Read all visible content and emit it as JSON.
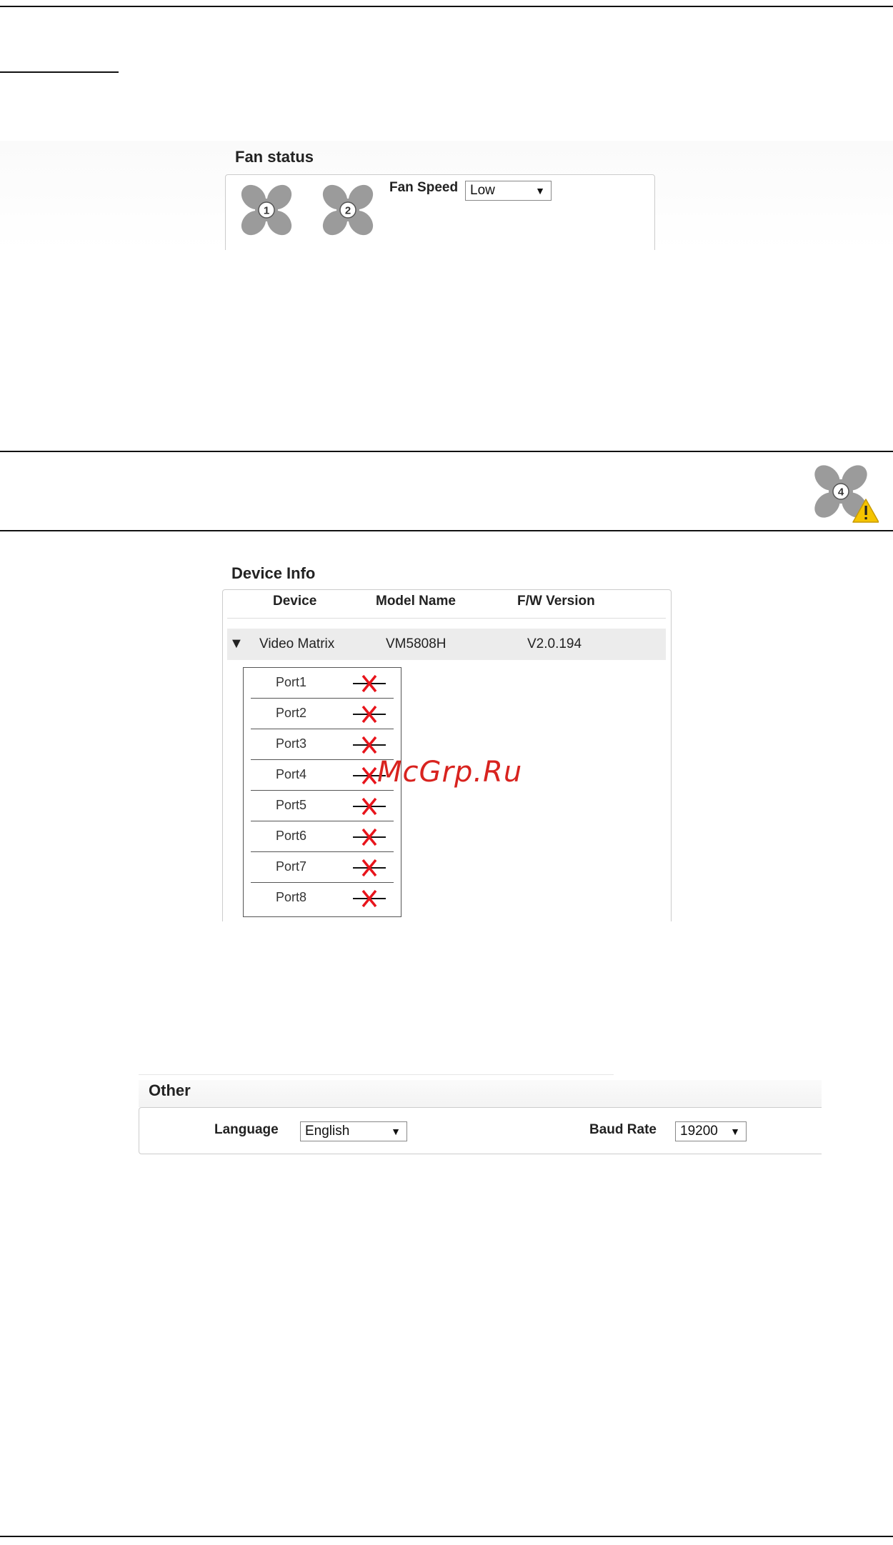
{
  "fan_status": {
    "title": "Fan status",
    "fans": [
      {
        "number": "1",
        "icon": "fan-icon"
      },
      {
        "number": "2",
        "icon": "fan-icon"
      }
    ],
    "speed_label": "Fan Speed",
    "speed_value": "Low"
  },
  "fan_warning": {
    "number": "4",
    "icon": "fan-warning-icon"
  },
  "device_info": {
    "title": "Device Info",
    "headers": [
      "Device",
      "Model Name",
      "F/W Version"
    ],
    "device": {
      "name": "Video Matrix",
      "model": "VM5808H",
      "firmware": "V2.0.194",
      "expand_icon": "triangle-down-icon"
    },
    "ports": [
      {
        "label": "Port1",
        "status_icon": "disconnected-icon"
      },
      {
        "label": "Port2",
        "status_icon": "disconnected-icon"
      },
      {
        "label": "Port3",
        "status_icon": "disconnected-icon"
      },
      {
        "label": "Port4",
        "status_icon": "disconnected-icon"
      },
      {
        "label": "Port5",
        "status_icon": "disconnected-icon"
      },
      {
        "label": "Port6",
        "status_icon": "disconnected-icon"
      },
      {
        "label": "Port7",
        "status_icon": "disconnected-icon"
      },
      {
        "label": "Port8",
        "status_icon": "disconnected-icon"
      }
    ]
  },
  "watermark": "McGrp.Ru",
  "other": {
    "title": "Other",
    "language_label": "Language",
    "language_value": "English",
    "baud_label": "Baud Rate",
    "baud_value": "19200"
  },
  "colors": {
    "disconnect": "#e8141b",
    "fan_gray": "#9b9b9b",
    "warning": "#f5c400"
  }
}
